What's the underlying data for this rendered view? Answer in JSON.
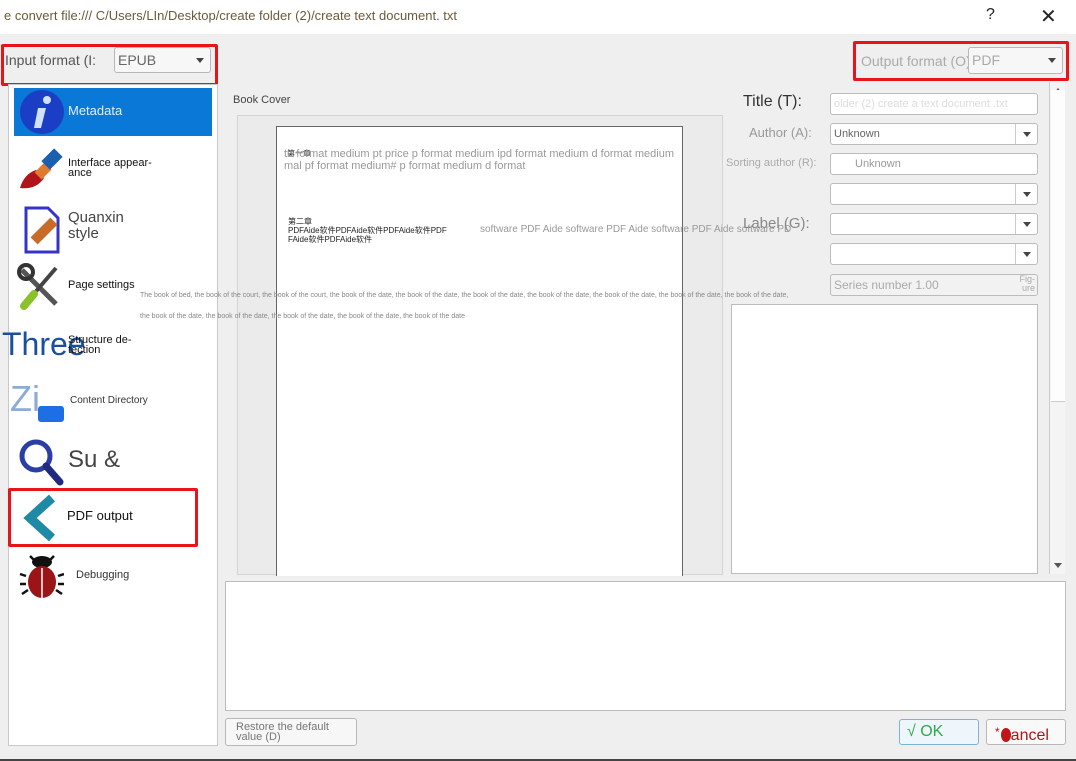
{
  "window": {
    "title": "e convert file:/// C/Users/LIn/Desktop/create folder (2)/create text document. txt",
    "help_label": "?",
    "close_label": "✕"
  },
  "input_format": {
    "label": "Input format (I:",
    "value": "EPUB"
  },
  "output_format": {
    "label": "Output format (O) :",
    "value": "PDF"
  },
  "sidebar": {
    "items": [
      {
        "label": "Metadata",
        "icon": "info-icon",
        "active": true
      },
      {
        "label": "Interface appear-\nance",
        "icon": "paintbrush-icon"
      },
      {
        "label": "Quanxin style",
        "icon": "document-edit-icon"
      },
      {
        "label": "Page settings",
        "icon": "tools-icon"
      },
      {
        "label": "Structure de-\ntection",
        "icon": "structure-icon",
        "overlay": "Three"
      },
      {
        "label": "Content Directory",
        "icon": "toc-icon",
        "overlay": "Zi"
      },
      {
        "label": "Su &",
        "icon": "search-icon"
      },
      {
        "label": "PDF output",
        "icon": "chevron-left-icon"
      },
      {
        "label": "Debugging",
        "icon": "bug-icon"
      }
    ]
  },
  "cover": {
    "label": "Book Cover",
    "chapter1": "第一章",
    "line1": "tu format medium pt price p format medium ipd format medium d format medium",
    "line2": "mal pf format medium# p format medium d format",
    "chapter2": "第二章",
    "chapter2_line1": "PDFAide软件PDFAide软件PDFAide软件PDF",
    "chapter2_line2": "FAide软件PDFAide软件",
    "overlay_text": "software PDF Aide software PDF Aide software PDF Aide software PD"
  },
  "bleed_text": {
    "line1": "The book of bed, the book of the court, the book of the court, the book of the date, the book of the date, the book of the date, the book of the date, the book of the date, the book of the date, the book of the date,",
    "line2": "the book of the date, the book of the date, the book of the date, the book of the date, the book of the date"
  },
  "metadata": {
    "title_label": "Title (T):",
    "title_value": "older (2) create a text document .txt",
    "author_label": "Author (A):",
    "author_value": "Unknown",
    "sort_author_label": "Sorting author (R):",
    "sort_author_value": "Unknown",
    "publisher_value": "",
    "tags_label": "Label (G):",
    "tags_value": "",
    "series_value": "",
    "series_number_placeholder": "Series number 1.00",
    "series_number_suffix": "Fig-\nure"
  },
  "buttons": {
    "restore_defaults": "Restore the default value (D)",
    "ok": "√ OK",
    "cancel_prefix": "*",
    "cancel": "ancel"
  }
}
